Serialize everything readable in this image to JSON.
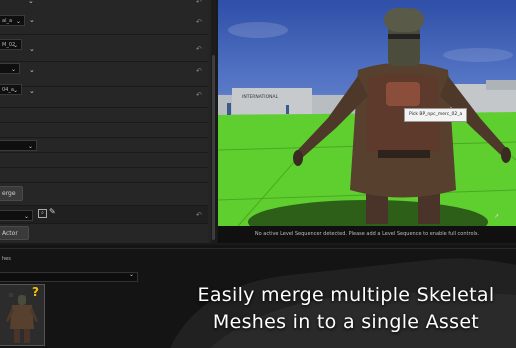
{
  "details": {
    "rows": [
      {
        "dropdown": "al_a",
        "reset": "↶"
      },
      {
        "dropdown": "M_02",
        "reset": "↶"
      },
      {
        "dropdown": "",
        "reset": "↶"
      },
      {
        "dropdown": "04_a",
        "reset": "↶"
      }
    ],
    "merge_button": "erge",
    "actor_button": "Actor",
    "reset_glyph": "↶"
  },
  "viewport": {
    "sign_text": "INTERNATIONAL",
    "tooltip": "Pick BP_npc_merc_02_a",
    "status": "No active Level Sequencer detected. Please add a Level Sequence to enable full controls."
  },
  "bottom": {
    "meshes_label": "hes",
    "thumbnail_badge": "?"
  },
  "caption": {
    "line1": "Easily merge multiple Skeletal",
    "line2": "Meshes in to a single Asset"
  },
  "colors": {
    "panel": "#242424",
    "floor_green": "#5fcf2f",
    "badge_yellow": "#f2c200"
  }
}
